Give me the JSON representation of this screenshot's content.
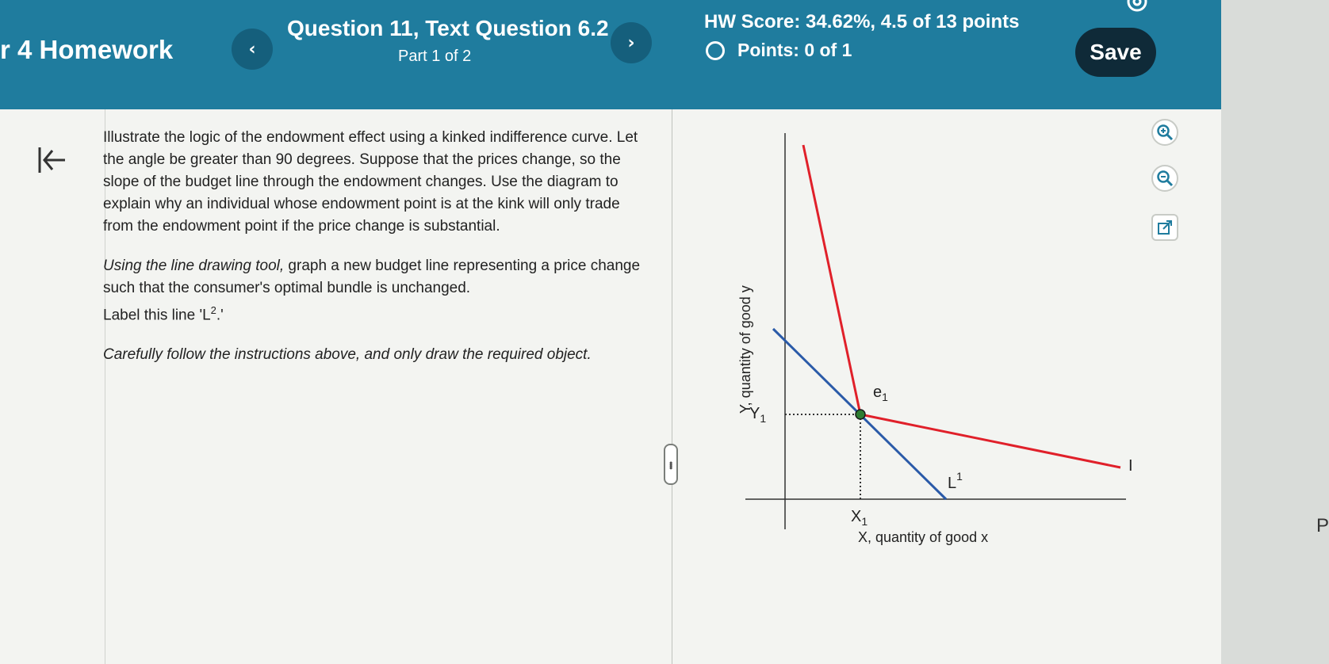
{
  "header": {
    "homework_title": "r 4 Homework",
    "prev_label": "‹",
    "next_label": "›",
    "question_title": "Question 11, Text Question 6.2",
    "question_part": "Part 1 of 2",
    "hw_score": "HW Score: 34.62%, 4.5 of 13 points",
    "points": "Points: 0 of 1",
    "save_label": "Save"
  },
  "instructions": {
    "paragraph1": "Illustrate the logic of the endowment effect using a kinked indifference curve. Let the angle be greater than 90 degrees. Suppose that the prices change, so the slope of the budget line through the endowment changes. Use the diagram to explain why an individual whose endowment point is at the kink will only trade from the endowment point if the price change is substantial.",
    "paragraph2_prefix": "Using the line drawing tool,",
    "paragraph2_rest": " graph a new budget line representing a price change such that the consumer's optimal bundle is unchanged.",
    "paragraph2_label_prefix": "Label this line 'L",
    "paragraph2_label_sup": "2",
    "paragraph2_label_suffix": ".'",
    "paragraph3": "Carefully follow the instructions above, and only draw the required object."
  },
  "graph": {
    "y_axis_label": "Y, quantity of good y",
    "x_axis_label": "X, quantity of good x",
    "y1_label": "Y",
    "y1_sub": "1",
    "x1_label": "X",
    "x1_sub": "1",
    "e1_label": "e",
    "e1_sub": "1",
    "l1_label": "L",
    "l1_sup": "1",
    "i_label": "I",
    "colors": {
      "indifference_curve": "#e0202a",
      "budget_line": "#2a5aa8",
      "endowment_point": "#2e7d32"
    }
  },
  "tools": {
    "zoom_in": "zoom-in-icon",
    "zoom_out": "zoom-out-icon",
    "popout": "popout-icon"
  },
  "right_edge_letter": "P"
}
